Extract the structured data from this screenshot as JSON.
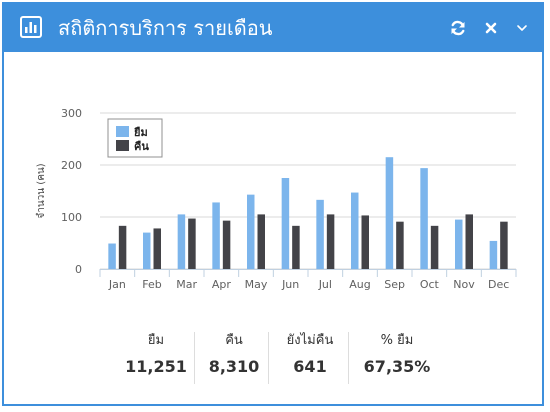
{
  "header": {
    "title": "สถิติการบริการ รายเดือน",
    "refresh_icon": "refresh-icon",
    "close_icon": "close-icon",
    "collapse_icon": "chevron-down-icon",
    "bg_color": "#3d8fdc"
  },
  "chart_data": {
    "type": "bar",
    "categories": [
      "Jan",
      "Feb",
      "Mar",
      "Apr",
      "May",
      "Jun",
      "Jul",
      "Aug",
      "Sep",
      "Oct",
      "Nov",
      "Dec"
    ],
    "series": [
      {
        "name": "ยืม",
        "color": "#7cb5ec",
        "values": [
          49,
          70,
          105,
          128,
          143,
          175,
          133,
          147,
          215,
          194,
          95,
          54
        ]
      },
      {
        "name": "คืน",
        "color": "#434348",
        "values": [
          83,
          78,
          97,
          93,
          105,
          83,
          105,
          103,
          91,
          83,
          105,
          91
        ]
      }
    ],
    "ylabel": "จำนวน (คน)",
    "ylim": [
      0,
      300
    ],
    "yticks": [
      0,
      100,
      200,
      300
    ],
    "grid": true,
    "legend": "top-left"
  },
  "stats": [
    {
      "label": "ยืม",
      "value": "11,251"
    },
    {
      "label": "คืน",
      "value": "8,310"
    },
    {
      "label": "ยังไม่คืน",
      "value": "641"
    },
    {
      "label": "% ยืม",
      "value": "67,35%"
    }
  ]
}
